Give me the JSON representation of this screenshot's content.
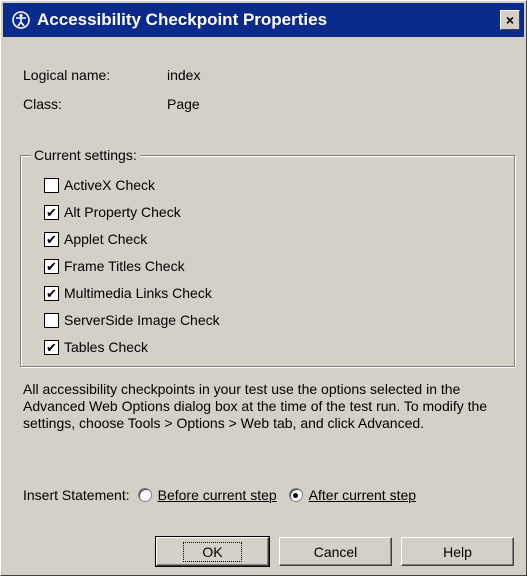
{
  "window": {
    "title": "Accessibility Checkpoint Properties",
    "close_label": "×"
  },
  "properties": {
    "logical_name_label": "Logical name:",
    "logical_name_value": "index",
    "class_label": "Class:",
    "class_value": "Page"
  },
  "settings": {
    "group_label": "Current settings:",
    "checks": [
      {
        "label": "ActiveX Check",
        "checked": false,
        "mark": ""
      },
      {
        "label": "Alt Property Check",
        "checked": true,
        "mark": "✔"
      },
      {
        "label": "Applet Check",
        "checked": true,
        "mark": "✔"
      },
      {
        "label": "Frame Titles Check",
        "checked": true,
        "mark": "✔"
      },
      {
        "label": "Multimedia Links Check",
        "checked": true,
        "mark": "✔"
      },
      {
        "label": "ServerSide Image Check",
        "checked": false,
        "mark": ""
      },
      {
        "label": "Tables Check",
        "checked": true,
        "mark": "✔"
      }
    ]
  },
  "note": "All accessibility checkpoints in your test use the options selected in the Advanced Web Options dialog box at the time of the test run. To modify the settings, choose Tools > Options > Web tab, and click Advanced.",
  "insert": {
    "label": "Insert Statement:",
    "options": [
      {
        "label": "Before current step",
        "selected": false
      },
      {
        "label": "After current step",
        "selected": true
      }
    ]
  },
  "buttons": {
    "ok": "OK",
    "cancel": "Cancel",
    "help": "Help"
  },
  "colors": {
    "titlebar": "#0a2a8c",
    "dialog_bg": "#d4d0c8"
  }
}
